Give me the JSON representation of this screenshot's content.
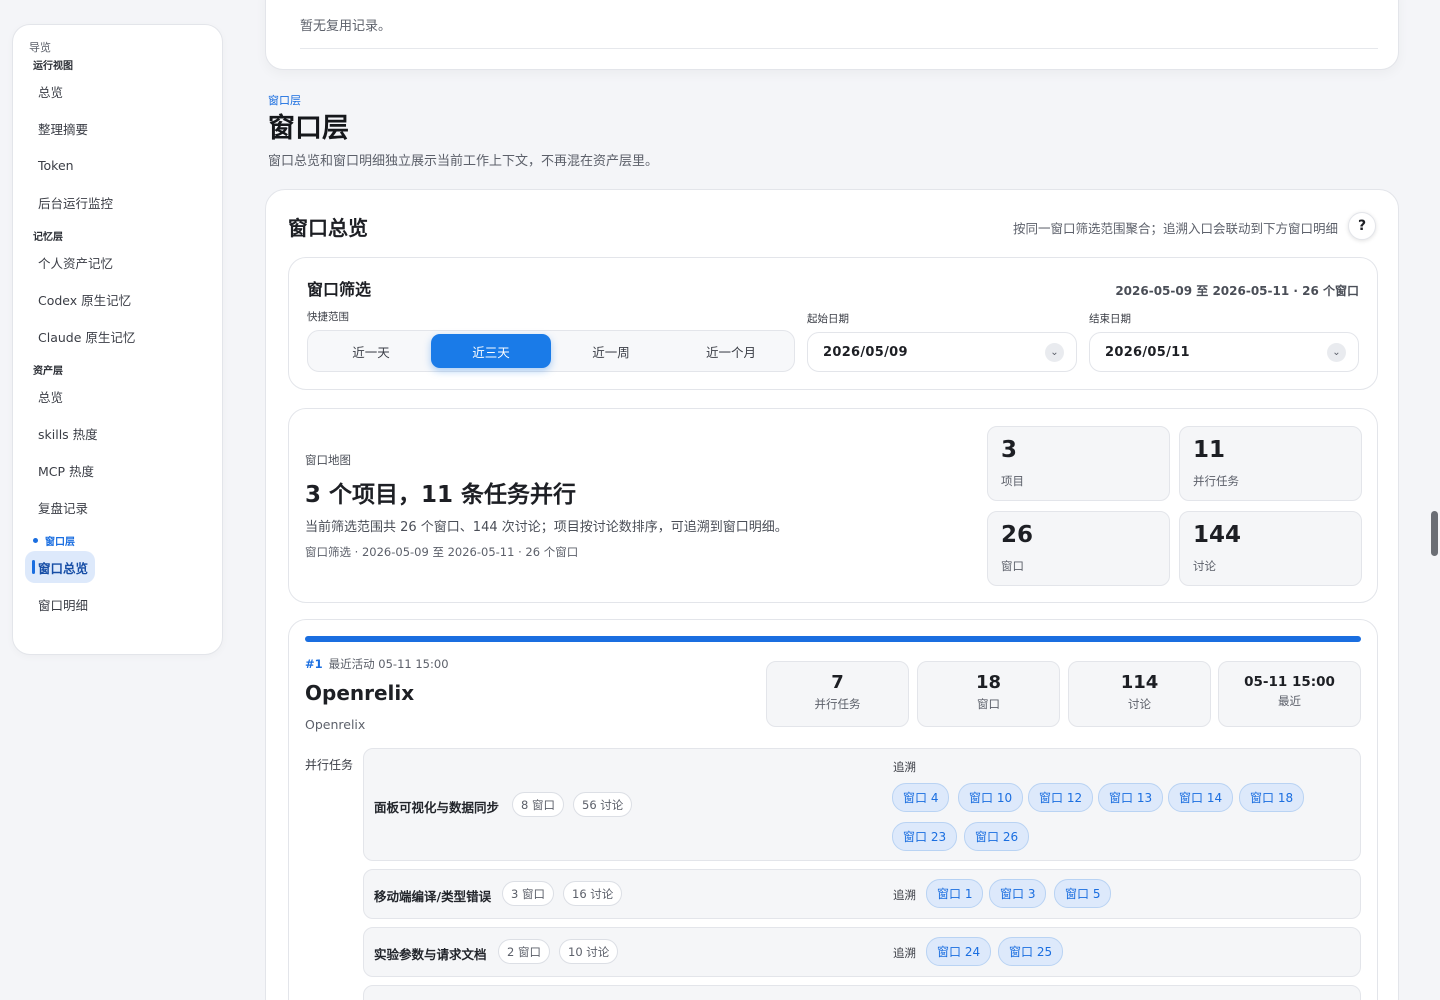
{
  "sidebar": {
    "title": "导览",
    "groups": [
      {
        "label": "运行视图",
        "items": [
          "总览",
          "整理摘要",
          "Token",
          "后台运行监控"
        ]
      },
      {
        "label": "记忆层",
        "items": [
          "个人资产记忆",
          "Codex 原生记忆",
          "Claude 原生记忆"
        ]
      },
      {
        "label": "资产层",
        "items": [
          "总览",
          "skills 热度",
          "MCP 热度",
          "复盘记录"
        ]
      },
      {
        "label": "窗口层",
        "items": [
          "窗口总览",
          "窗口明细"
        ]
      }
    ],
    "active_item": "窗口总览"
  },
  "top_card": {
    "empty_text": "暂无复用记录。"
  },
  "section": {
    "kicker": "窗口层",
    "title": "窗口层",
    "description": "窗口总览和窗口明细独立展示当前工作上下文，不再混在资产层里。"
  },
  "overview": {
    "title": "窗口总览",
    "hint": "按同一窗口筛选范围聚合；追溯入口会联动到下方窗口明细",
    "help": "?"
  },
  "filter": {
    "title": "窗口筛选",
    "range_summary": "2026-05-09 至 2026-05-11 · 26 个窗口",
    "quick_label": "快捷范围",
    "quick_options": [
      "近一天",
      "近三天",
      "近一周",
      "近一个月"
    ],
    "quick_selected": "近三天",
    "start_label": "起始日期",
    "start_value": "2026/05/09",
    "end_label": "结束日期",
    "end_value": "2026/05/11",
    "chevron": "⌄"
  },
  "map": {
    "kicker": "窗口地图",
    "headline": "3 个项目，11 条任务并行",
    "description": "当前筛选范围共 26 个窗口、144 次讨论；项目按讨论数排序，可追溯到窗口明细。",
    "meta": "窗口筛选 · 2026-05-09 至 2026-05-11 · 26 个窗口",
    "stats": [
      {
        "value": "3",
        "label": "项目"
      },
      {
        "value": "11",
        "label": "并行任务"
      },
      {
        "value": "26",
        "label": "窗口"
      },
      {
        "value": "144",
        "label": "讨论"
      }
    ]
  },
  "project": {
    "rank": "#1",
    "last_activity": "最近活动 05-11 15:00",
    "name": "Openrelix",
    "subtitle": "Openrelix",
    "stats": [
      {
        "value": "7",
        "label": "并行任务"
      },
      {
        "value": "18",
        "label": "窗口"
      },
      {
        "value": "114",
        "label": "讨论"
      },
      {
        "value": "05-11 15:00",
        "label": "最近"
      }
    ],
    "tasks_label": "并行任务",
    "trace_label": "追溯",
    "tasks": [
      {
        "name": "面板可视化与数据同步",
        "windows": "8 窗口",
        "discussions": "56 讨论",
        "refs": [
          "窗口 4",
          "窗口 10",
          "窗口 12",
          "窗口 13",
          "窗口 14",
          "窗口 18",
          "窗口 23",
          "窗口 26"
        ]
      },
      {
        "name": "移动端编译/类型错误",
        "windows": "3 窗口",
        "discussions": "16 讨论",
        "refs": [
          "窗口 1",
          "窗口 3",
          "窗口 5"
        ]
      },
      {
        "name": "实验参数与请求文档",
        "windows": "2 窗口",
        "discussions": "10 讨论",
        "refs": [
          "窗口 24",
          "窗口 25"
        ]
      }
    ]
  }
}
